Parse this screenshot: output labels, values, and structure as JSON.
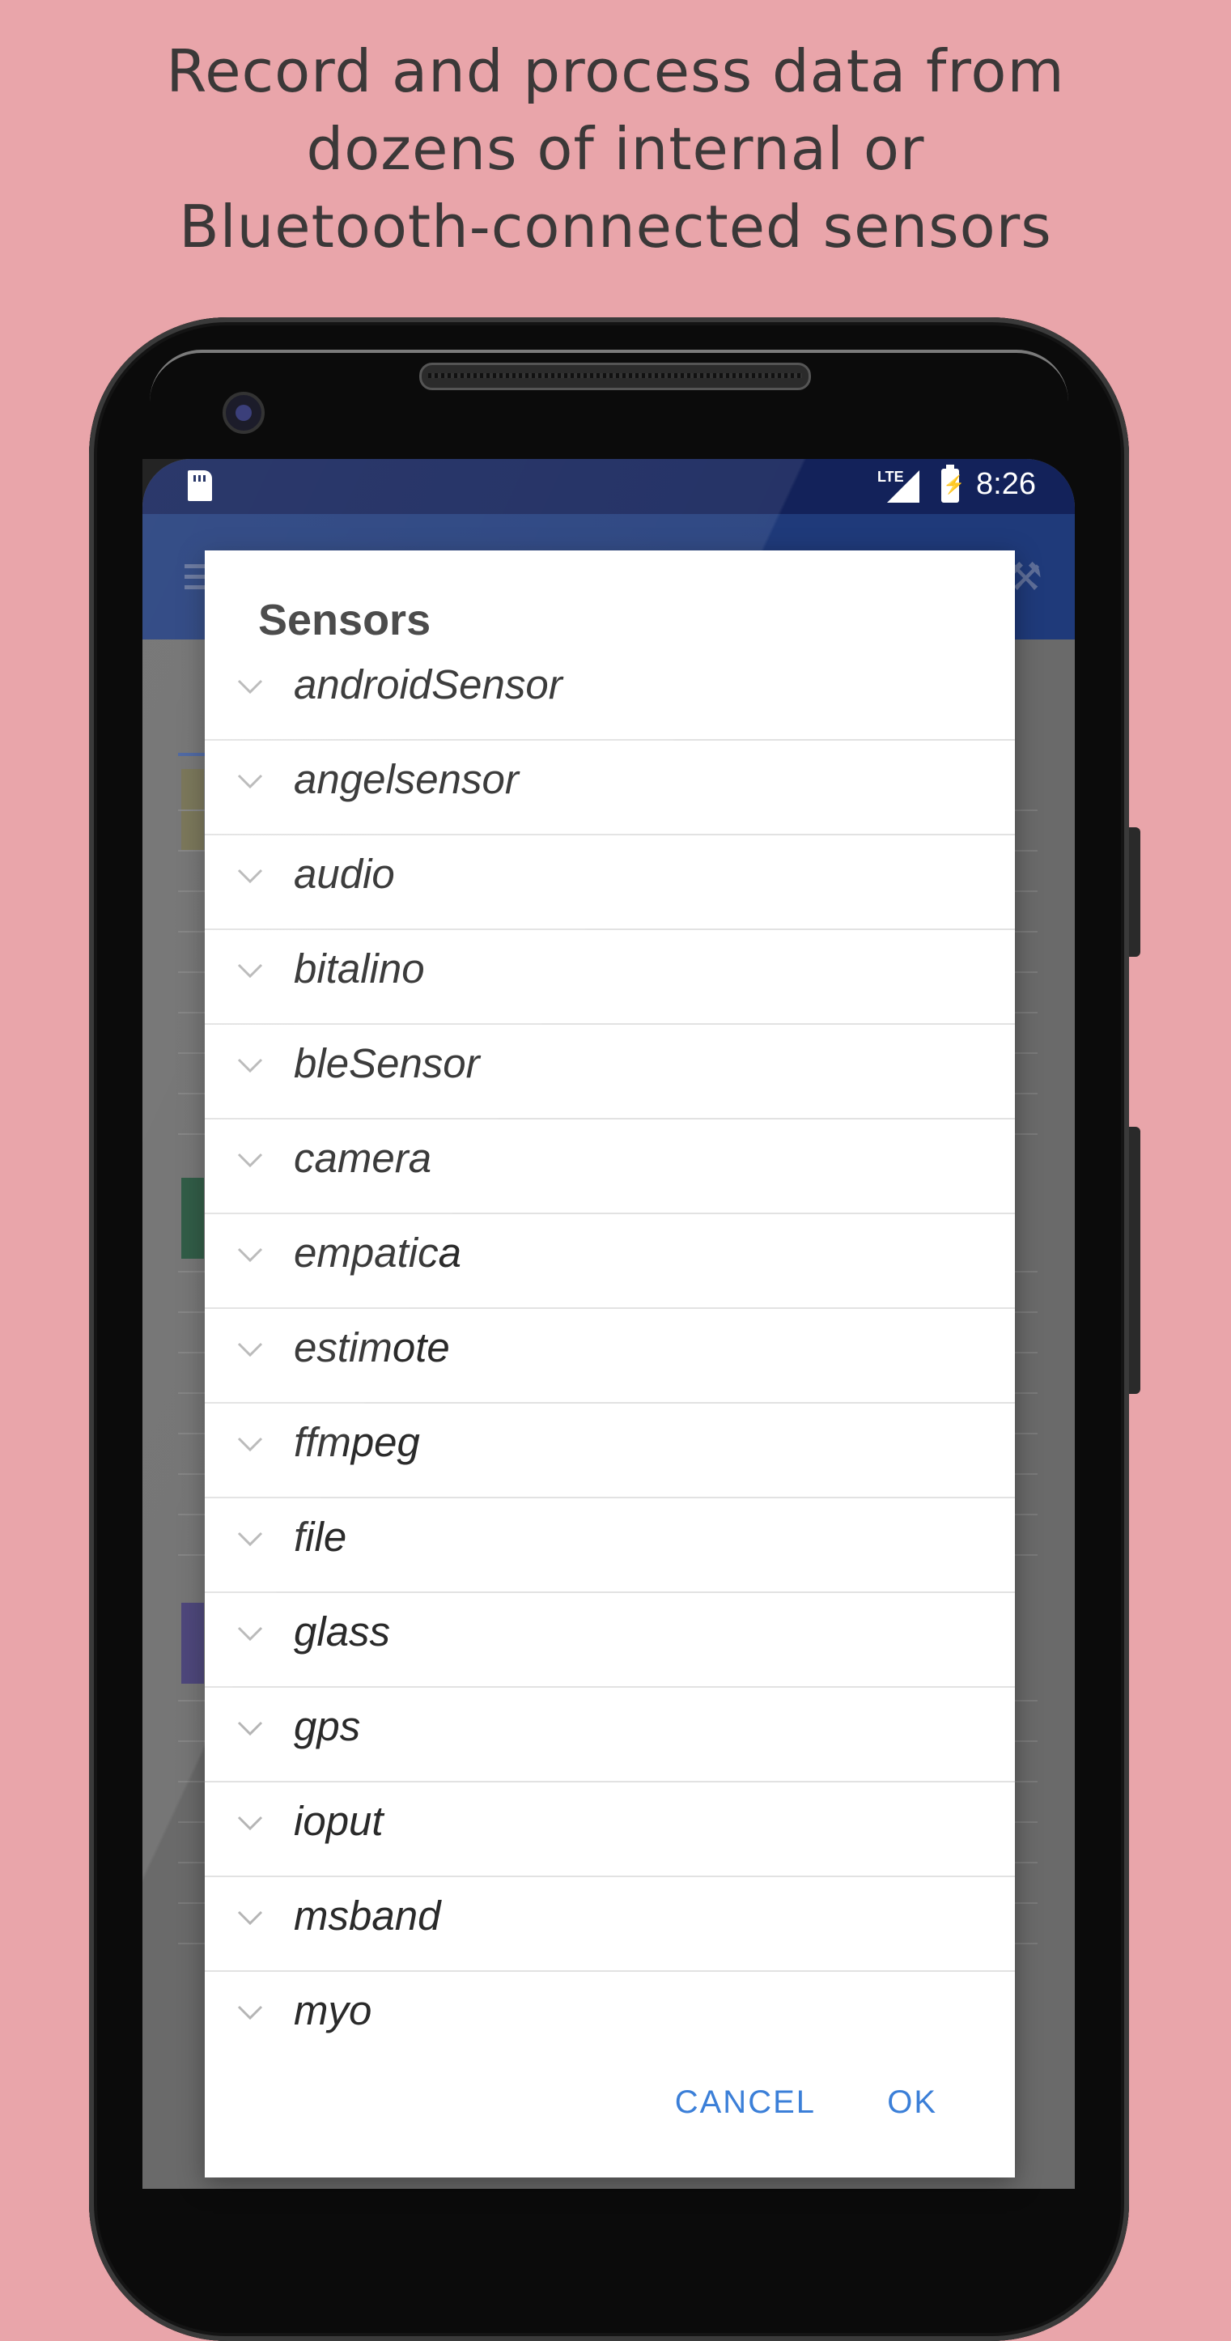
{
  "headline": {
    "line1": "Record and process data from",
    "line2": "dozens of internal or",
    "line3": "Bluetooth-connected sensors"
  },
  "statusbar": {
    "network": "LTE",
    "time": "8:26",
    "icons": [
      "sd-card-icon",
      "signal-icon",
      "battery-charging-icon"
    ]
  },
  "appbar": {
    "icons": [
      "menu-icon",
      "tools-icon"
    ]
  },
  "dialog": {
    "title": "Sensors",
    "items": [
      {
        "label": "androidSensor"
      },
      {
        "label": "angelsensor"
      },
      {
        "label": "audio"
      },
      {
        "label": "bitalino"
      },
      {
        "label": "bleSensor"
      },
      {
        "label": "camera"
      },
      {
        "label": "empatica"
      },
      {
        "label": "estimote"
      },
      {
        "label": "ffmpeg"
      },
      {
        "label": "file"
      },
      {
        "label": "glass"
      },
      {
        "label": "gps"
      },
      {
        "label": "ioput"
      },
      {
        "label": "msband"
      },
      {
        "label": "myo"
      }
    ],
    "cancel_label": "CANCEL",
    "ok_label": "OK"
  },
  "colors": {
    "background": "#e9a5aa",
    "accent": "#3b7fd8",
    "appbar": "#1f3a7a",
    "statusbar": "#13225a"
  }
}
